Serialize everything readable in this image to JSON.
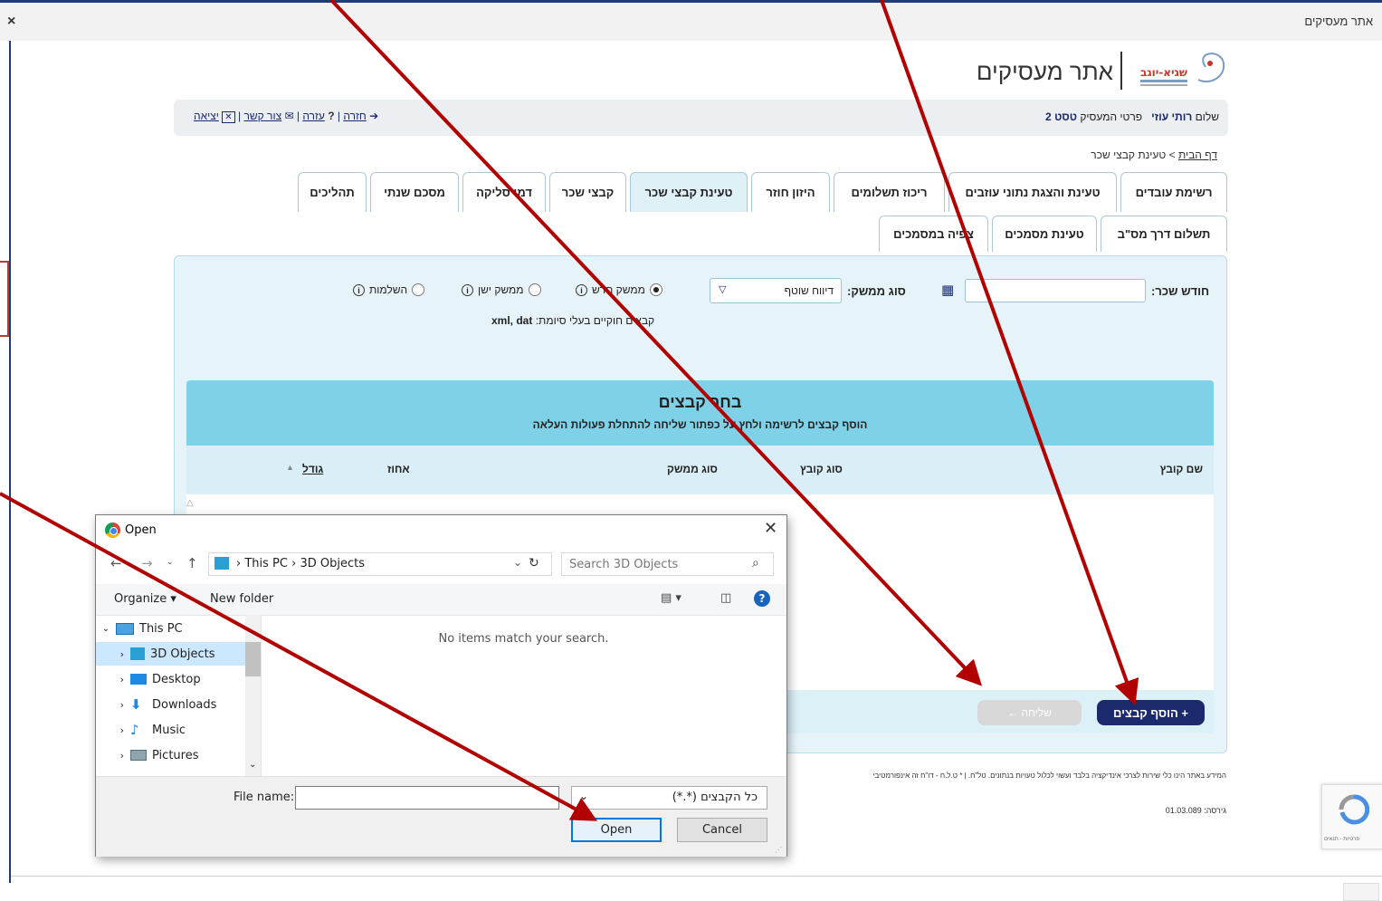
{
  "window": {
    "title": "אתר מעסיקים",
    "close_glyph": "×"
  },
  "header": {
    "site_title": "אתר מעסיקים",
    "logo_text": "שגיא-יוגב",
    "greeting_prefix": "שלום",
    "user_name": "רותי עוזי",
    "employer_details_prefix": "פרטי המעסיק",
    "employer_name": "טסט 2",
    "links": {
      "back": "חזרה",
      "help": "עזרה",
      "contact": "צור קשר",
      "exit": "יציאה"
    }
  },
  "breadcrumb": {
    "home": "דף הבית",
    "separator": ">",
    "current": "טעינת קבצי שכר"
  },
  "tabs_row1": [
    "רשימת עובדים",
    "טעינת והצגת נתוני עוזבים",
    "ריכוז תשלומים",
    "היזון חוזר",
    "טעינת קבצי שכר",
    "קבצי שכר",
    "דמי סליקה",
    "מסכם שנתי",
    "תהליכים"
  ],
  "tabs_row2": [
    "תשלום דרך מס\"ב",
    "טעינת מסמכים",
    "צפיה במסמכים"
  ],
  "active_tab": "טעינת קבצי שכר",
  "form": {
    "salary_month_label": "חודש שכר:",
    "salary_month_value": "",
    "economy_type_label": "סוג ממשק:",
    "economy_type_value": "דיווח שוטף",
    "radio_options": [
      {
        "label": "ממשק חדש",
        "checked": true
      },
      {
        "label": "ממשק ישן",
        "checked": false
      },
      {
        "label": "השלמות",
        "checked": false
      }
    ],
    "file_hint_prefix": "קבצים חוקיים בעלי סיומת:",
    "file_hint_ext": "xml, dat"
  },
  "chooser": {
    "title": "בחר קבצים",
    "subtitle": "הוסף קבצים לרשימה ולחץ על כפתור שליחה להתחלת פעולות העלאה",
    "columns": [
      "שם קובץ",
      "סוג קובץ",
      "סוג ממשק",
      "אחוז",
      "גודל"
    ],
    "add_button": "+ הוסף קבצים",
    "send_button": "שליחה ←"
  },
  "footer": {
    "note": "המידע באתר הינו כלי שירות לצרכי אינדיקציה בלבד ועשוי לכלול טעויות בנתונים. טל\"ח.   |   * ט.ל.ח - דו\"ח זה אינפורמטיבי",
    "version": "גירסה: 01.03.089"
  },
  "recaptcha": {
    "text": "פרטיות - תנאים"
  },
  "dialog": {
    "title": "Open",
    "path": [
      "This PC",
      "3D Objects"
    ],
    "search_placeholder": "Search 3D Objects",
    "organize": "Organize ▾",
    "new_folder": "New folder",
    "nav_items": [
      {
        "label": "This PC",
        "icon": "pc-icon",
        "selected": false
      },
      {
        "label": "3D Objects",
        "icon": "cube-icon",
        "selected": true
      },
      {
        "label": "Desktop",
        "icon": "desktop-icon",
        "selected": false
      },
      {
        "label": "Downloads",
        "icon": "download-icon",
        "selected": false
      },
      {
        "label": "Music",
        "icon": "music-icon",
        "selected": false
      },
      {
        "label": "Pictures",
        "icon": "pictures-icon",
        "selected": false
      }
    ],
    "empty_message": "No items match your search.",
    "file_name_label": "File name:",
    "file_name_value": "",
    "file_type_value": "כל הקבצים (*.*)",
    "open_button": "Open",
    "cancel_button": "Cancel"
  },
  "colors": {
    "brand_navy": "#1a2a6c",
    "panel_bg": "#e6f4f9",
    "chooser_header": "#7fd1e8",
    "annotation_arrow": "#b20000",
    "dialog_accent": "#0078d7"
  }
}
